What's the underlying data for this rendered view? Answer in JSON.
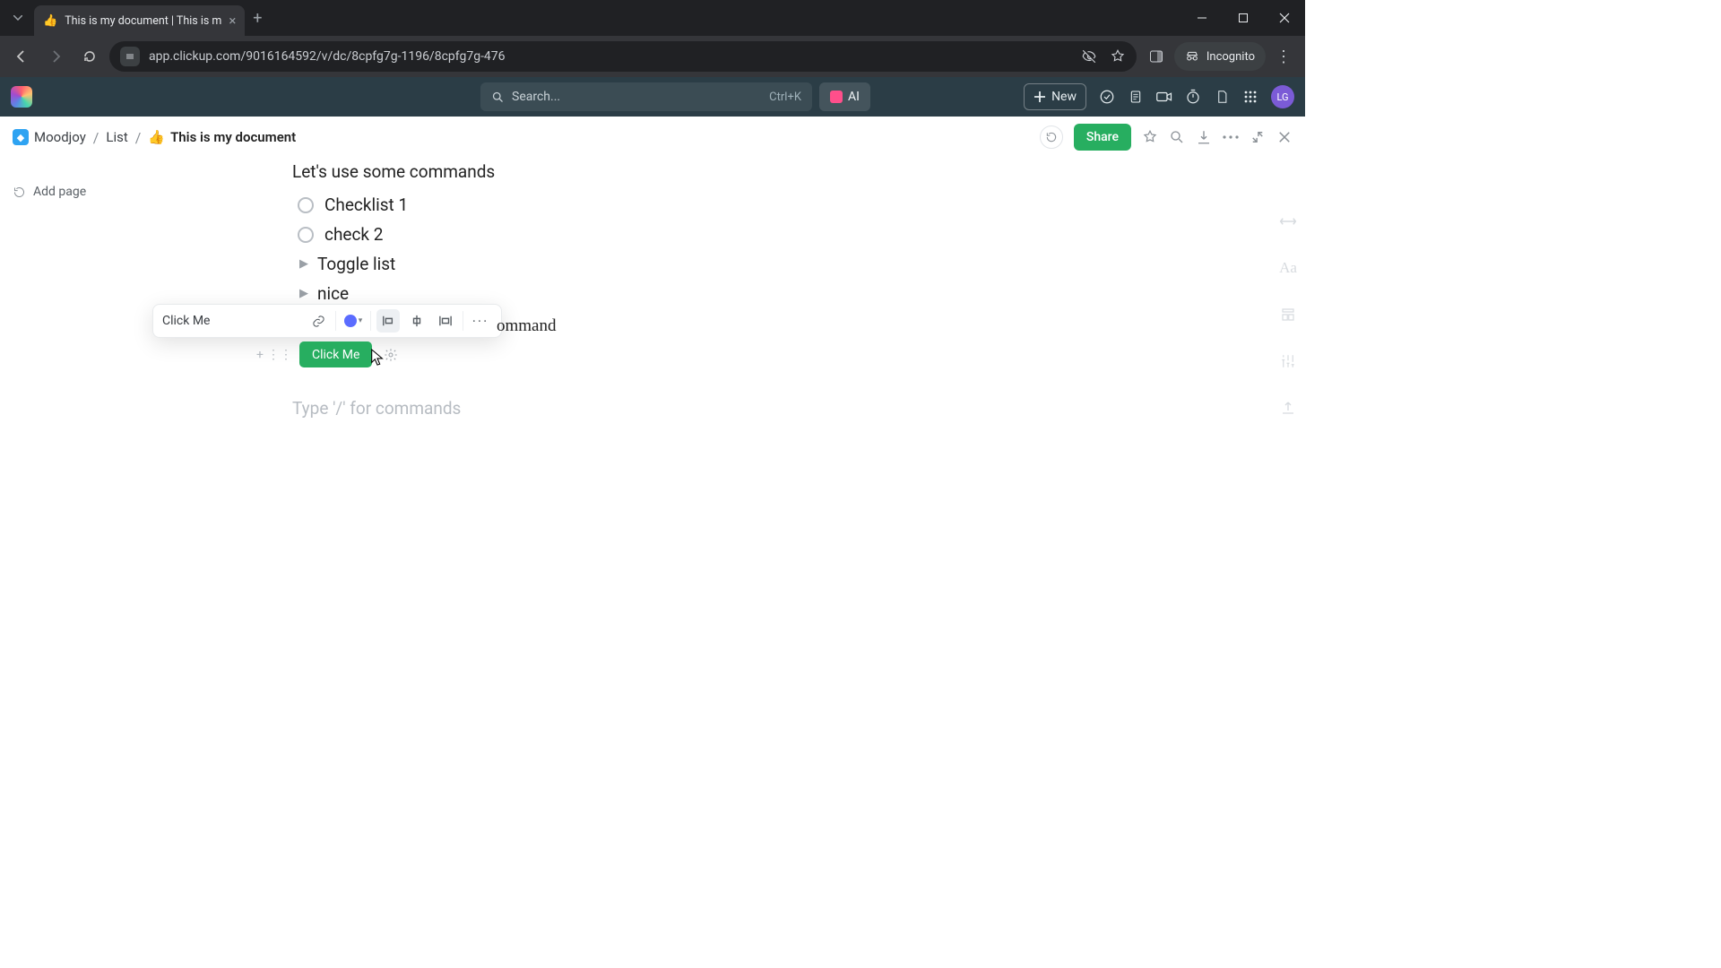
{
  "browser": {
    "tab_title": "This is my document | This is m",
    "new_tab_tooltip": "+",
    "url": "app.clickup.com/9016164592/v/dc/8cpfg7g-1196/8cpfg7g-476",
    "incognito_label": "Incognito"
  },
  "topbar": {
    "search_placeholder": "Search...",
    "search_shortcut": "Ctrl+K",
    "ai_label": "AI",
    "new_label": "New",
    "avatar_initials": "LG"
  },
  "breadcrumbs": {
    "workspace": "Moodjoy",
    "list": "List",
    "doc_emoji": "👍",
    "doc_title": "This is my document",
    "share_label": "Share"
  },
  "sidebar": {
    "add_page_label": "Add page"
  },
  "doc": {
    "heading": "Let's use some commands",
    "check1": "Checklist 1",
    "check2": "check 2",
    "toggle1": "Toggle list",
    "toggle2": "nice",
    "partial_text": "ommand",
    "button_label": "Click Me",
    "placeholder": "Type '/' for commands"
  },
  "popover": {
    "label_input_value": "Click Me"
  }
}
